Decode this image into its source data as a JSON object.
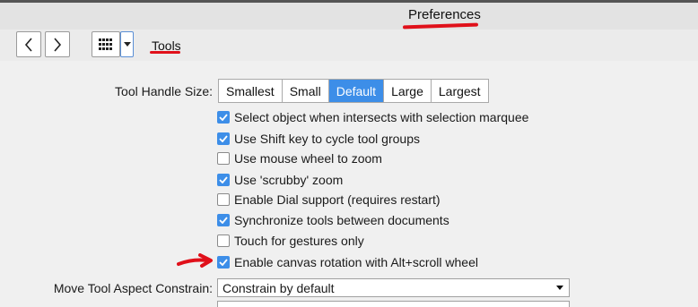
{
  "window": {
    "title": "Preferences"
  },
  "toolbar": {
    "section_label": "Tools",
    "back_glyph": "<",
    "forward_glyph": ">",
    "grid_icon": "grid-icon",
    "dropdown_icon": "chevron-down-icon"
  },
  "tools": {
    "handle_size_label": "Tool Handle Size:",
    "handle_sizes": [
      "Smallest",
      "Small",
      "Default",
      "Large",
      "Largest"
    ],
    "handle_size_selected": "Default",
    "options": [
      {
        "label": "Select object when intersects with selection marquee",
        "checked": true
      },
      {
        "label": "Use Shift key to cycle tool groups",
        "checked": true
      },
      {
        "label": "Use mouse wheel to zoom",
        "checked": false
      },
      {
        "label": "Use 'scrubby' zoom",
        "checked": true
      },
      {
        "label": "Enable Dial support (requires restart)",
        "checked": false
      },
      {
        "label": "Synchronize tools between documents",
        "checked": true
      },
      {
        "label": "Touch for gestures only",
        "checked": false
      },
      {
        "label": "Enable canvas rotation with Alt+scroll wheel",
        "checked": true
      }
    ],
    "aspect_label": "Move Tool Aspect Constrain:",
    "aspect_value": "Constrain by default"
  },
  "colors": {
    "accent": "#3d8ee8",
    "annotation": "#e0101a"
  }
}
